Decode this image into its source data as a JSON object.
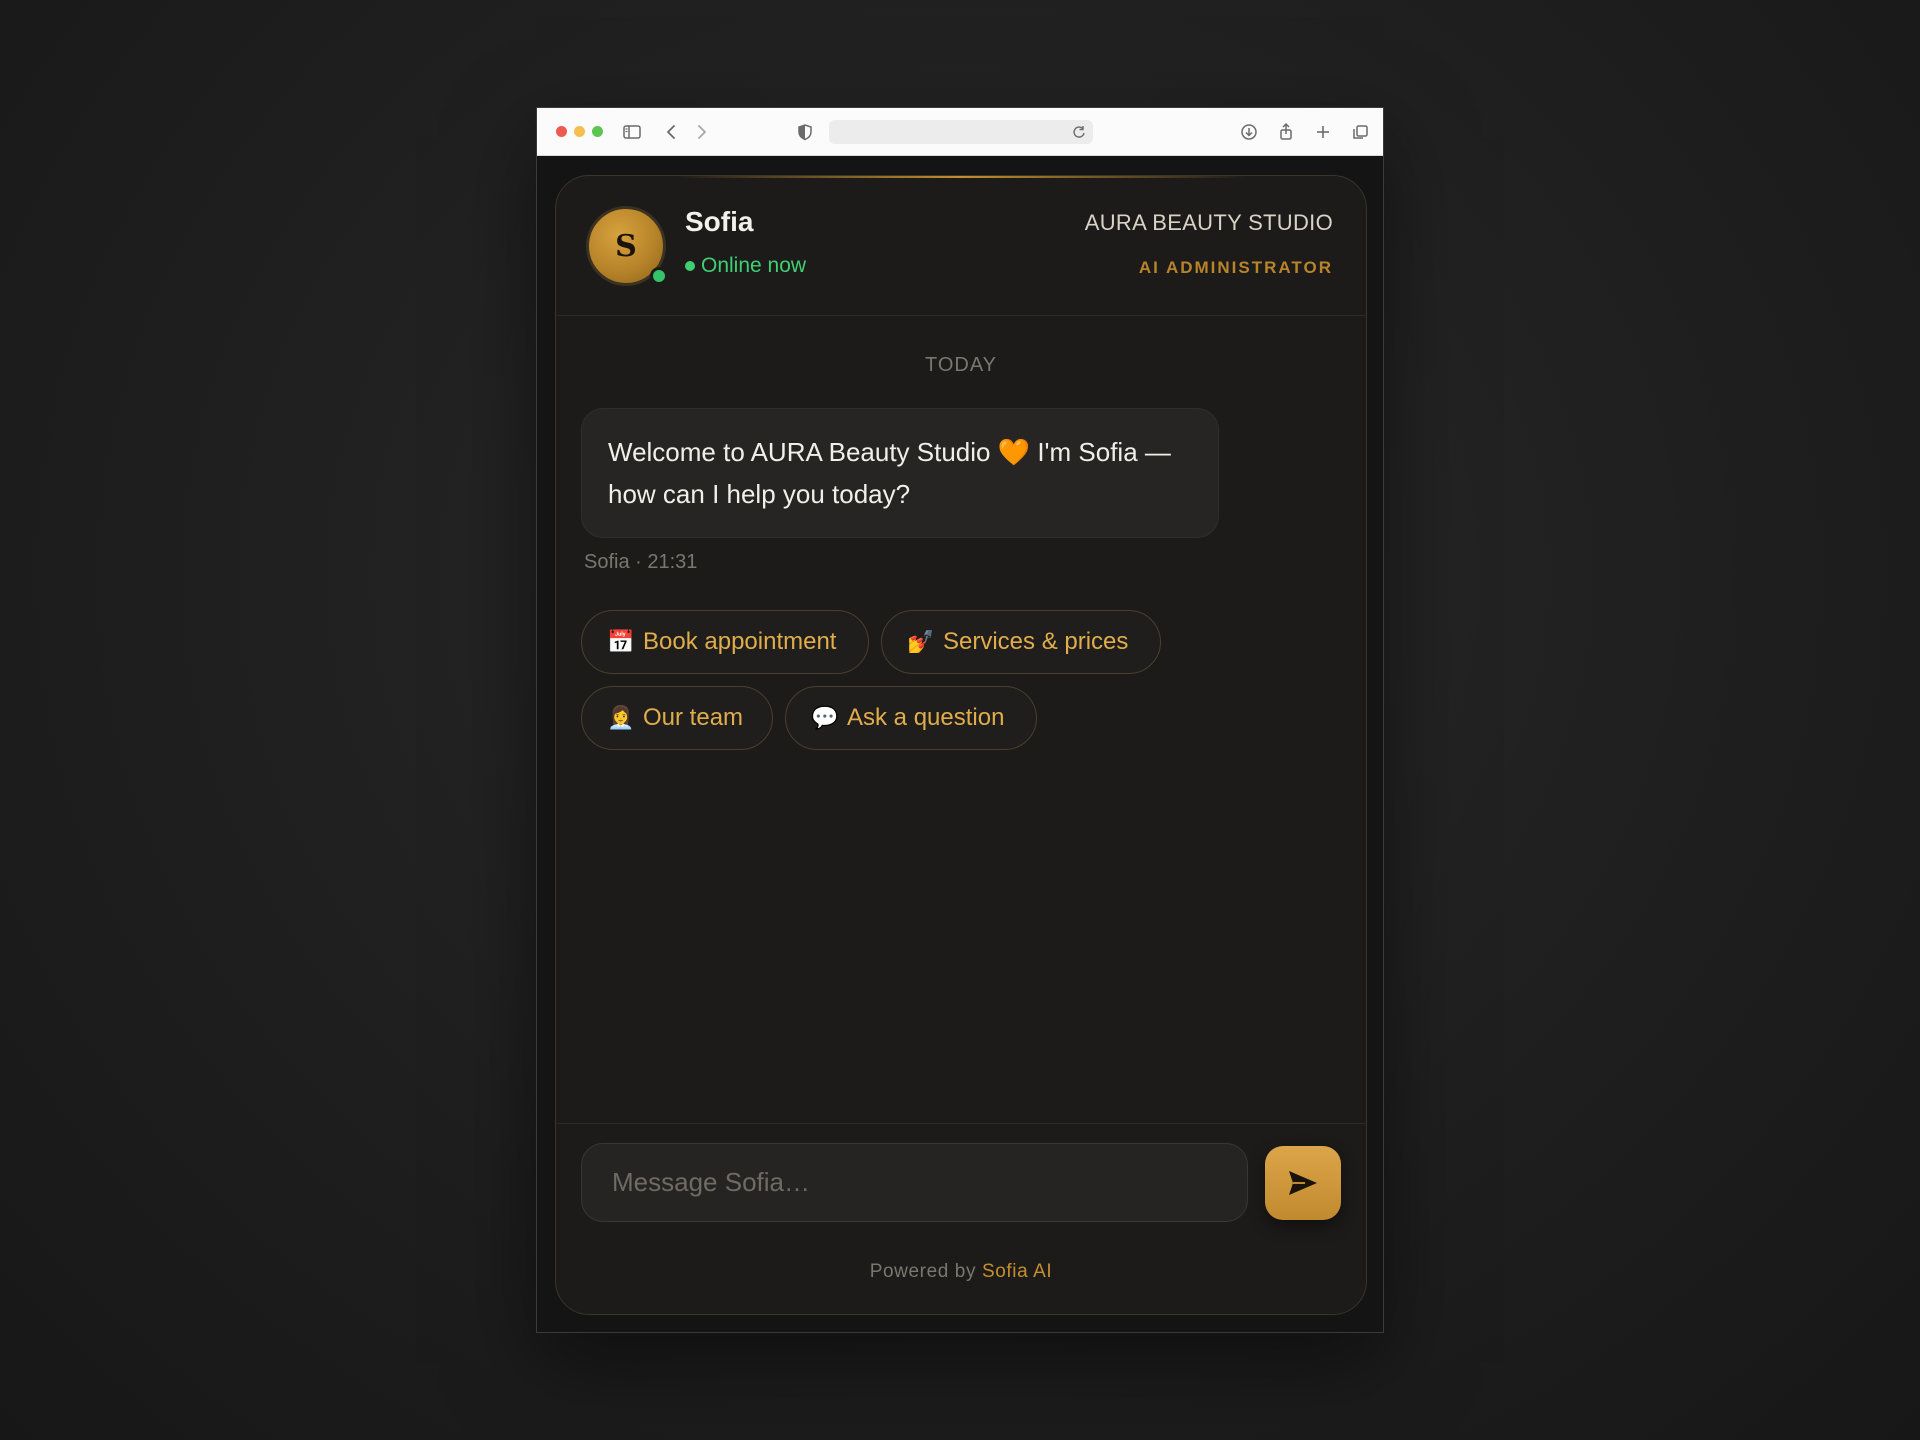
{
  "browser": {
    "url_text": ""
  },
  "chat": {
    "agent_name": "Sofia",
    "agent_initial": "S",
    "status": "Online now",
    "studio_name": "AURA BEAUTY STUDIO",
    "role": "AI ADMINISTRATOR",
    "day_label": "TODAY",
    "message": {
      "text": "Welcome to AURA Beauty Studio 🧡 I'm Sofia — how can I help you today?",
      "meta": "Sofia · 21:31"
    },
    "quick_replies": [
      {
        "emoji": "📅",
        "label": "Book appointment"
      },
      {
        "emoji": "💅",
        "label": "Services & prices"
      },
      {
        "emoji": "👩‍💼",
        "label": "Our team"
      },
      {
        "emoji": "💬",
        "label": "Ask a question"
      }
    ],
    "input_placeholder": "Message Sofia…",
    "footer_prefix": "Powered by",
    "footer_brand": "Sofia AI"
  },
  "colors": {
    "accent_gold": "#c58f2d",
    "online_green": "#3fcf72",
    "background": "#1c1b1a"
  },
  "icons": [
    "sidebar-icon",
    "back-icon",
    "forward-icon",
    "privacy-shield-icon",
    "reload-icon",
    "download-icon",
    "share-icon",
    "new-tab-icon",
    "tabs-overview-icon",
    "send-icon"
  ]
}
